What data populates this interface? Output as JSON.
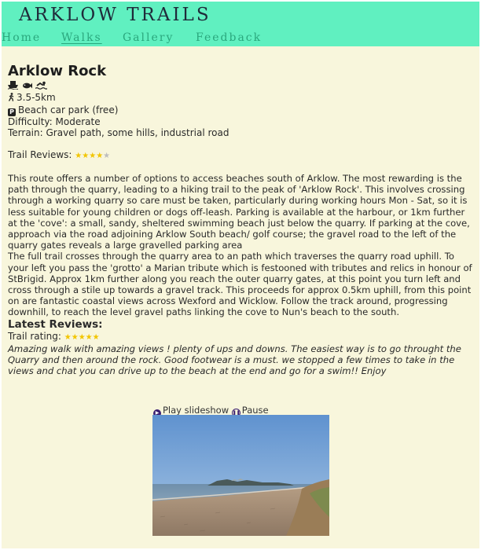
{
  "header": {
    "brand": "ARKLOW TRAILS",
    "nav": [
      {
        "label": "Home"
      },
      {
        "label": "Walks"
      },
      {
        "label": "Gallery"
      },
      {
        "label": "Feedback"
      }
    ]
  },
  "trail": {
    "title": "Arklow Rock",
    "feature_icons": [
      "boat-icon",
      "fish-icon",
      "swimmer-icon"
    ],
    "distance": "3.5-5km",
    "parking": "Beach car park (free)",
    "difficulty": "Difficulty: Moderate",
    "terrain": "Terrain: Gravel path, some hills, industrial road",
    "reviews_label": "Trail Reviews:",
    "reviews_stars": 4,
    "description_1": "This route offers a number of options to access beaches south of Arklow. The most rewarding is the path through the quarry, leading to a hiking trail to the peak of 'Arklow Rock'. This involves crossing through a working quarry so care must be taken, particularly during working hours Mon - Sat, so it is less suitable for young children or dogs off-leash. Parking is available at the harbour, or 1km further at the 'cove': a small, sandy, sheltered swimming beach just below the quarry. If parking at the cove, approach via the road adjoining Arklow South beach/ golf course; the gravel road to the left of the quarry gates reveals a large gravelled parking area",
    "description_2": "The full trail crosses through the quarry area to an path which traverses the quarry road uphill. To your left you pass the 'grotto' a Marian tribute which is festooned with tributes and relics in honour of StBrigid. Approx 1km further along you reach the outer quarry gates, at this point you turn left and cross through a stile up towards a gravel track. This proceeds for approx 0.5km uphill, from this point on are fantastic coastal views across Wexford and Wicklow. Follow the track around, progressing downhill, to reach the level gravel paths linking the cove to Nun's beach to the south."
  },
  "latest_reviews": {
    "heading": "Latest Reviews:",
    "rating_label": "Trail rating:",
    "rating_stars": 5,
    "text": "Amazing walk with amazing views ! plenty of ups and downs. The easiest way is to go throught the Quarry and then around the rock. Good footwear is a must. we stopped a few times to take in the views and chat you can drive up to the beach at the end and go for a swim!! Enjoy"
  },
  "slideshow": {
    "play_label": "Play slideshow",
    "pause_label": "Pause"
  },
  "colors": {
    "header_bg": "#60f0c0",
    "page_bg": "#f8f6dc",
    "nav_text": "#2aa77d",
    "star": "#f2c500"
  }
}
